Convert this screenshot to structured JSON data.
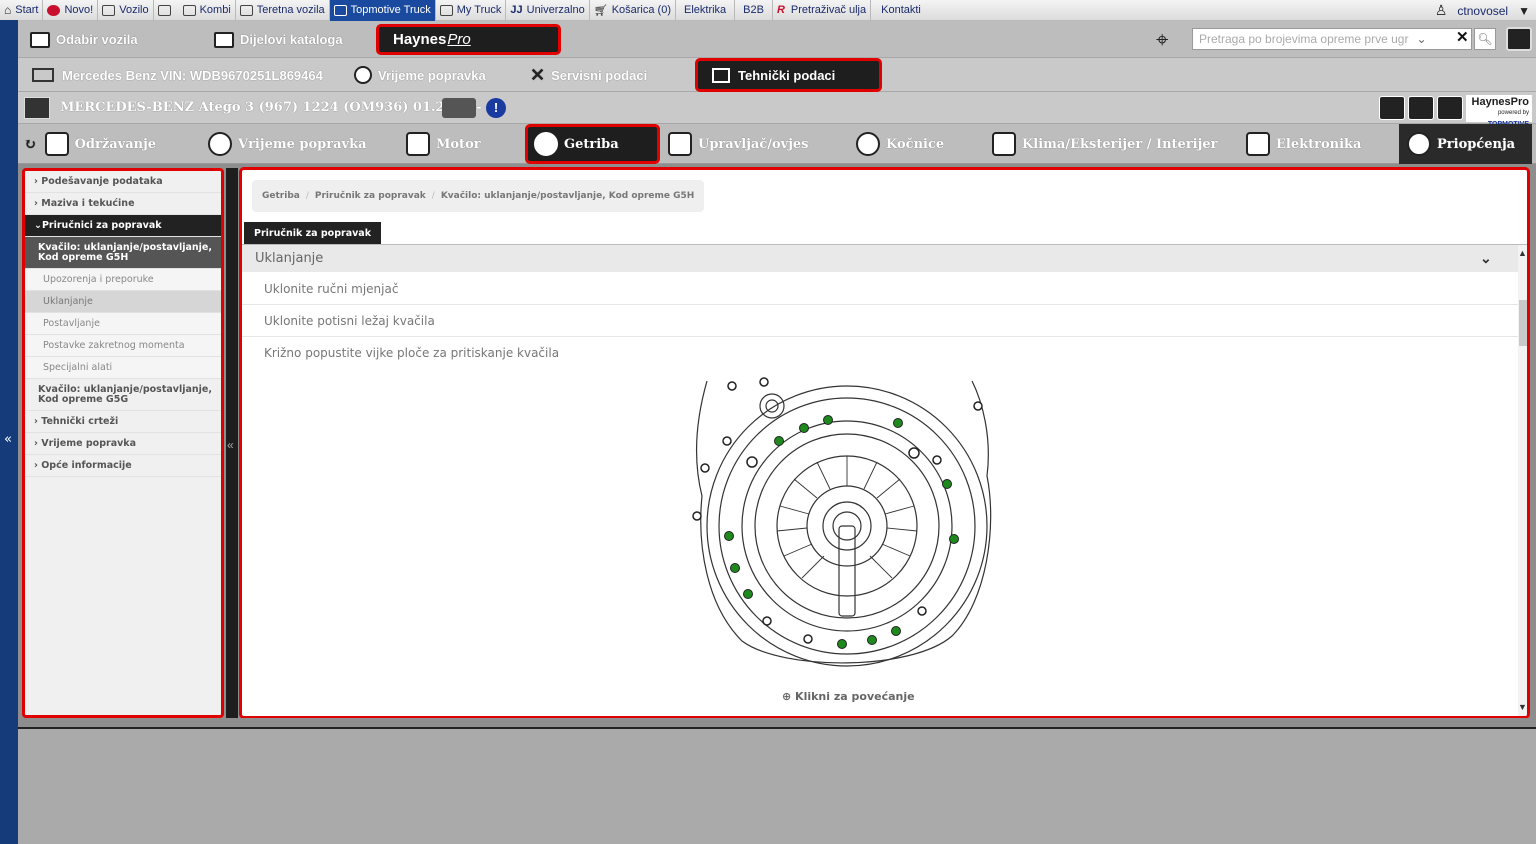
{
  "topmenu": {
    "items": [
      {
        "label": "Start",
        "icon": "home-icon"
      },
      {
        "label": "Novo!",
        "icon": "new-icon"
      },
      {
        "label": "Vozilo",
        "icon": "car-icon"
      },
      {
        "label": "",
        "icon": "checkbox-icon"
      },
      {
        "label": "Kombi",
        "icon": "van-icon"
      },
      {
        "label": "Teretna vozila",
        "icon": "truck-icon"
      },
      {
        "label": "Topmotive Truck",
        "icon": "truck-icon",
        "active": true
      },
      {
        "label": "My Truck",
        "icon": "truck-icon"
      },
      {
        "label": "Univerzalno",
        "icon": "universal-icon"
      },
      {
        "label": "Košarica (0)",
        "icon": "cart-icon"
      },
      {
        "label": "Elektrika",
        "icon": ""
      },
      {
        "label": "B2B",
        "icon": ""
      },
      {
        "label": "Pretraživač ulja",
        "icon": "oil-search-icon"
      },
      {
        "label": "Kontakti",
        "icon": ""
      }
    ],
    "user": "ctnovosel"
  },
  "row2": {
    "odabir": "Odabir vozila",
    "dijelovi": "Dijelovi kataloga",
    "haynes_brand": "Haynes",
    "haynes_pro": "Pro",
    "search_placeholder": "Pretraga po brojevima opreme prve ugr"
  },
  "row3": {
    "vin": "Mercedes Benz VIN: WDB9670251L869464",
    "vrijeme": "Vrijeme popravka",
    "servisni": "Servisni podaci",
    "tehnicki": "Tehnički podaci"
  },
  "row4": {
    "vehicle": "MERCEDES-BENZ Atego 3 (967) 1224 (OM936) 01.2013 -",
    "info": "!",
    "badge_brand": "HaynesPro",
    "badge_sub": "powered by",
    "badge_owner": "TOPMOTIVE"
  },
  "tabs": [
    {
      "label": "Održavanje",
      "icon": "checklist-icon"
    },
    {
      "label": "Vrijeme popravka",
      "icon": "clock-icon"
    },
    {
      "label": "Motor",
      "icon": "piston-icon"
    },
    {
      "label": "Getriba",
      "icon": "gearbox-icon",
      "active": true
    },
    {
      "label": "Upravljač/ovjes",
      "icon": "suspension-icon"
    },
    {
      "label": "Kočnice",
      "icon": "brake-disc-icon"
    },
    {
      "label": "Klima/Eksterijer / Interijer",
      "icon": "seat-icon"
    },
    {
      "label": "Elektronika",
      "icon": "chip-icon"
    },
    {
      "label": "Priopćenja",
      "icon": "lightbulb-icon"
    }
  ],
  "sidebar": {
    "items": [
      {
        "label": "Podešavanje podataka",
        "type": "top"
      },
      {
        "label": "Maziva i tekućine",
        "type": "top"
      },
      {
        "label": "Priručnici za popravak",
        "type": "head"
      },
      {
        "label": "Kvačilo: uklanjanje/postavljanje, Kod opreme G5H",
        "type": "sub"
      },
      {
        "label": "Upozorenja i preporuke",
        "type": "leaf"
      },
      {
        "label": "Uklanjanje",
        "type": "leaf-sel"
      },
      {
        "label": "Postavljanje",
        "type": "leaf"
      },
      {
        "label": "Postavke zakretnog momenta",
        "type": "leaf"
      },
      {
        "label": "Specijalni alati",
        "type": "leaf"
      },
      {
        "label": "Kvačilo: uklanjanje/postavljanje, Kod opreme G5G",
        "type": "two"
      },
      {
        "label": "Tehnički crteži",
        "type": "top"
      },
      {
        "label": "Vrijeme popravka",
        "type": "top"
      },
      {
        "label": "Opće informacije",
        "type": "top"
      }
    ]
  },
  "main": {
    "breadcrumb": [
      "Getriba",
      "Priručnik za popravak",
      "Kvačilo: uklanjanje/postavljanje, Kod opreme G5H"
    ],
    "tab": "Priručnik za popravak",
    "section": "Uklanjanje",
    "steps": [
      "Uklonite ručni mjenjač",
      "Uklonite potisni ležaj kvačila",
      "Križno popustite vijke ploče za pritiskanje kvačila"
    ],
    "zoom": "Klikni za povećanje"
  },
  "colors": {
    "highlight": "#e00000",
    "dark": "#1e1e1e",
    "accent_blue": "#1a4aa0",
    "bolt_green": "#1e8a1e"
  }
}
